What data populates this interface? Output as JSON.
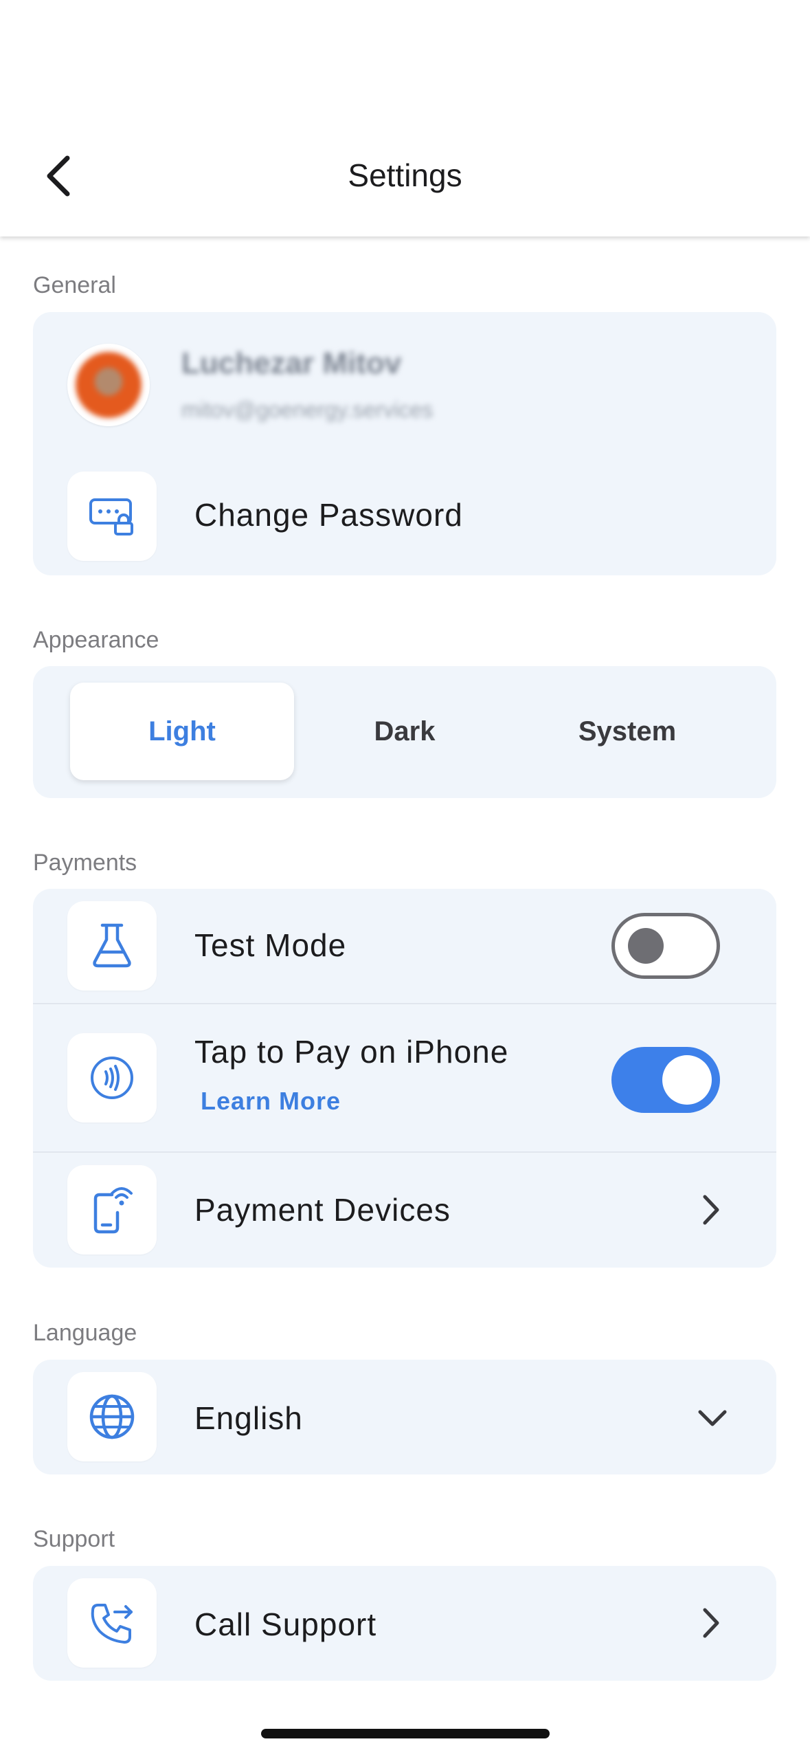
{
  "header": {
    "title": "Settings"
  },
  "general": {
    "label": "General",
    "user_name": "Luchezar Mitov",
    "user_email": "mitov@goenergy.services",
    "change_password": "Change Password"
  },
  "appearance": {
    "label": "Appearance",
    "options": [
      "Light",
      "Dark",
      "System"
    ],
    "selected": "Light"
  },
  "payments": {
    "label": "Payments",
    "test_mode": {
      "label": "Test Mode",
      "enabled": false
    },
    "tap_to_pay": {
      "label": "Tap to Pay on iPhone",
      "link": "Learn More",
      "enabled": true
    },
    "payment_devices": "Payment Devices"
  },
  "language": {
    "label": "Language",
    "value": "English"
  },
  "support": {
    "label": "Support",
    "call_support": "Call Support"
  },
  "colors": {
    "accent": "#3d80ea",
    "card_bg": "#f0f5fb",
    "section_label": "#7c7c80"
  }
}
